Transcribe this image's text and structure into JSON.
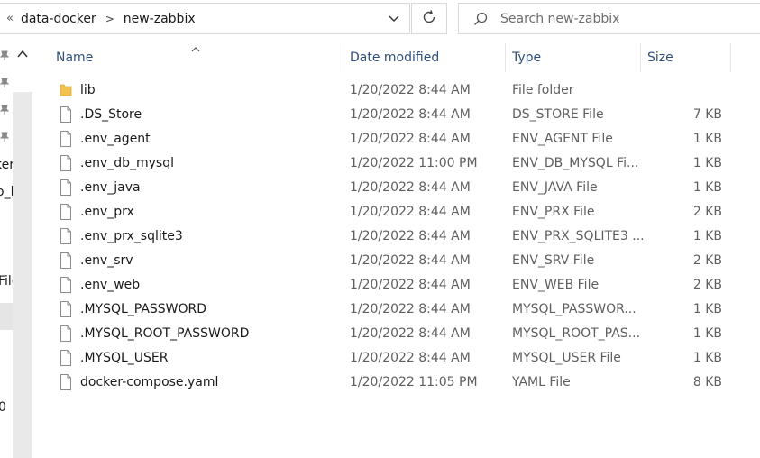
{
  "address_bar": {
    "overflow_glyph": "«",
    "breadcrumbs": [
      "data-docker",
      "new-zabbix"
    ],
    "separator": ">"
  },
  "search": {
    "placeholder": "Search new-zabbix"
  },
  "columns": {
    "name": "Name",
    "date": "Date modified",
    "type": "Type",
    "size": "Size"
  },
  "sidebar": {
    "partial_labels": [
      "ker",
      "o_l",
      "File",
      "0"
    ]
  },
  "files": [
    {
      "name": "lib",
      "date": "1/20/2022 8:44 AM",
      "type": "File folder",
      "size": "",
      "icon": "folder-icon"
    },
    {
      "name": ".DS_Store",
      "date": "1/20/2022 8:44 AM",
      "type": "DS_STORE File",
      "size": "7 KB",
      "icon": "file-icon"
    },
    {
      "name": ".env_agent",
      "date": "1/20/2022 8:44 AM",
      "type": "ENV_AGENT File",
      "size": "1 KB",
      "icon": "file-icon"
    },
    {
      "name": ".env_db_mysql",
      "date": "1/20/2022 11:00 PM",
      "type": "ENV_DB_MYSQL Fi...",
      "size": "1 KB",
      "icon": "file-icon"
    },
    {
      "name": ".env_java",
      "date": "1/20/2022 8:44 AM",
      "type": "ENV_JAVA File",
      "size": "1 KB",
      "icon": "file-icon"
    },
    {
      "name": ".env_prx",
      "date": "1/20/2022 8:44 AM",
      "type": "ENV_PRX File",
      "size": "2 KB",
      "icon": "file-icon"
    },
    {
      "name": ".env_prx_sqlite3",
      "date": "1/20/2022 8:44 AM",
      "type": "ENV_PRX_SQLITE3 ...",
      "size": "1 KB",
      "icon": "file-icon"
    },
    {
      "name": ".env_srv",
      "date": "1/20/2022 8:44 AM",
      "type": "ENV_SRV File",
      "size": "2 KB",
      "icon": "file-icon"
    },
    {
      "name": ".env_web",
      "date": "1/20/2022 8:44 AM",
      "type": "ENV_WEB File",
      "size": "2 KB",
      "icon": "file-icon"
    },
    {
      "name": ".MYSQL_PASSWORD",
      "date": "1/20/2022 8:44 AM",
      "type": "MYSQL_PASSWOR...",
      "size": "1 KB",
      "icon": "file-icon"
    },
    {
      "name": ".MYSQL_ROOT_PASSWORD",
      "date": "1/20/2022 8:44 AM",
      "type": "MYSQL_ROOT_PAS...",
      "size": "1 KB",
      "icon": "file-icon"
    },
    {
      "name": ".MYSQL_USER",
      "date": "1/20/2022 8:44 AM",
      "type": "MYSQL_USER File",
      "size": "1 KB",
      "icon": "file-icon"
    },
    {
      "name": "docker-compose.yaml",
      "date": "1/20/2022 11:05 PM",
      "type": "YAML File",
      "size": "8 KB",
      "icon": "file-icon"
    }
  ],
  "colors": {
    "header_text": "#2f4f7a",
    "folder": "#f2c14e",
    "border": "#d9d9d9"
  }
}
